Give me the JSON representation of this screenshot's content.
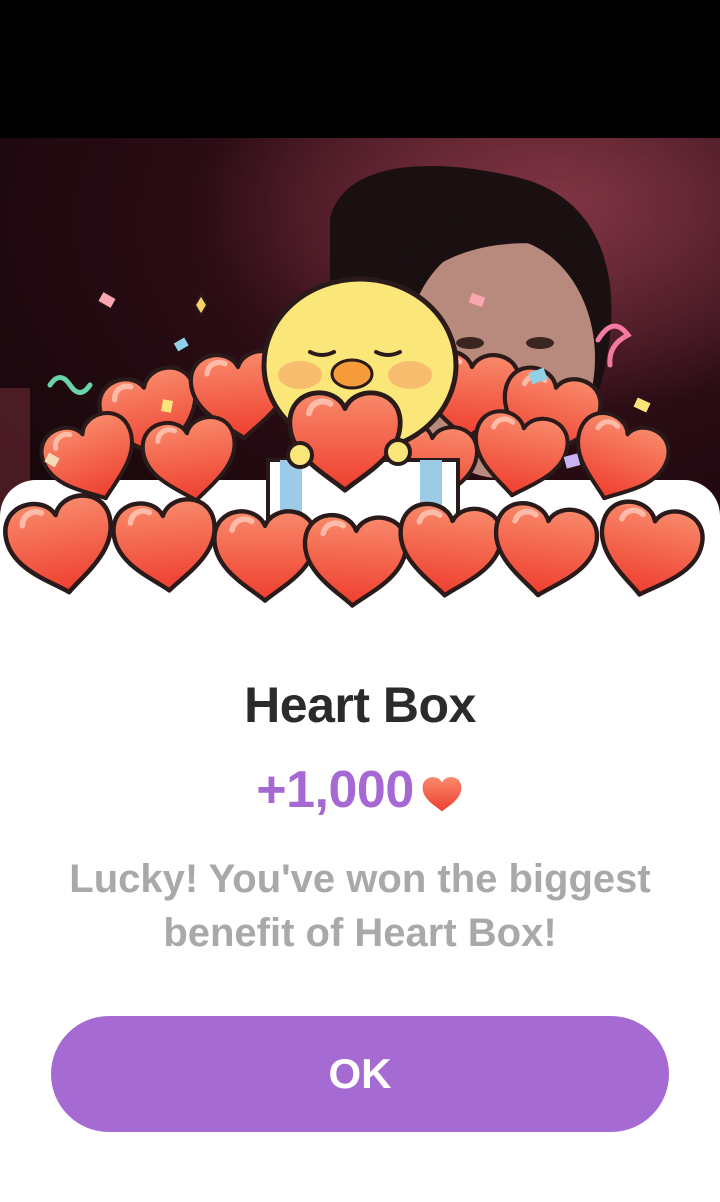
{
  "dialog": {
    "title": "Heart Box",
    "reward_amount": "+1,000",
    "message": "Lucky! You've won the biggest benefit of Heart Box!",
    "ok_label": "OK"
  },
  "icons": {
    "reward_icon": "heart-icon",
    "illustration": "chick-with-hearts"
  },
  "colors": {
    "accent": "#a66bd3",
    "reward_text": "#a669d4",
    "title_text": "#2b2b2b",
    "message_text": "#a9a9a9",
    "heart_fill": "#f4674a"
  }
}
